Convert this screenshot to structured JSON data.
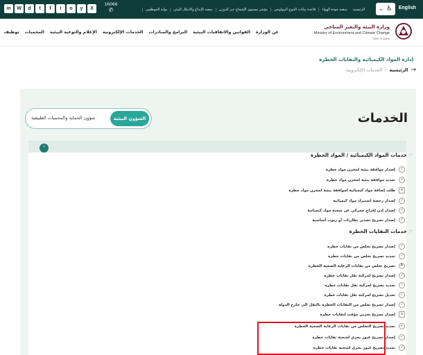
{
  "topbar": {
    "language": "English",
    "links": [
      "الرئيسية",
      "منصة جودة الهواء",
      "قاعدة بيانات التنوع البيولوجي",
      "مؤشر مستوى الإشعاع عبر الدوزن",
      "منصة الإبداع والابتكار البيئي",
      "بوابة الموظفين"
    ],
    "phone": "16066",
    "socials": [
      "in",
      "W",
      "d",
      "t",
      "f",
      "i",
      "o",
      "y",
      "X"
    ]
  },
  "header": {
    "logo_ar": "وزارة البيئة والتغير المناخي",
    "logo_en": "Ministry of Environment and Climate Change",
    "logo_sub": "State of Qatar",
    "nav": [
      "عن الوزارة",
      "القوانين والاتفاقيات البيئية",
      "البرامج والمبادرات",
      "الخدمات الإلكترونية",
      "الإعلام والتوعية البيئية",
      "المحميات",
      "توظيف"
    ]
  },
  "breadcrumb": {
    "home": "الرئيسية",
    "separator": "/",
    "current": "الخدمات الإلكترونية"
  },
  "main": {
    "title": "الخدمات",
    "toggle": {
      "active": "الشؤون البيئية",
      "other": "شؤون الحماية والمحميات الطبيعية"
    }
  },
  "category": {
    "title": "إدارة المواد الكيميائية والنفايات الخطرة",
    "groups": [
      {
        "title": "خدمات المواد الكيميائية / المواد الخطرة",
        "items": [
          {
            "label": "إصدار موافقة بيئية لمخزن مواد خطرة",
            "icon": "check"
          },
          {
            "label": "تجديد موافقة بيئية لمخزن مواد خطرة",
            "icon": "plus"
          },
          {
            "label": "طلب إضافة مواد كيميائية لموافقة بيئية لمخزن مواد خطرة",
            "icon": "doc"
          },
          {
            "label": "إصدار رخصة استيراد مواد كيميائية",
            "icon": "check"
          },
          {
            "label": "إصدار إذن إفراج جمركي عن شحنة مواد كيميائية",
            "icon": "check"
          },
          {
            "label": "إصدار تصريح تصدير بطاريات أو زيوت أساسية",
            "icon": "check"
          }
        ]
      },
      {
        "title": "خدمات النفايات الخطرة",
        "items": [
          {
            "label": "إصدار تصريح تخلص من نفايات خطرة",
            "icon": "check"
          },
          {
            "label": "تجديد تصريح تخلص من نفايات خطرة",
            "icon": "check"
          },
          {
            "label": "تصريح تخلص من نفايات الرعاية الصحية الخطرة",
            "icon": "leaf"
          },
          {
            "label": "إصدار تصريح لمركبة نقل نفايات خطرة",
            "icon": "check"
          },
          {
            "label": "تجديد تصريح لمركبة نقل نفايات خطرة",
            "icon": "check"
          },
          {
            "label": "تعديل تصريح لمركبة نقل نفايات خطرة",
            "icon": "check"
          },
          {
            "label": "إصدار تصريح تخلص من النفايات الخطرة بالنقل الى خارج الدولة",
            "icon": "check"
          },
          {
            "label": "إصدار تصريح تخزين مؤقت لنفايات خطرة",
            "icon": "doc"
          },
          {
            "label": "تجديد تصريح التخلص من نفايات الرعاية الصحية الخطرة",
            "icon": "plus"
          },
          {
            "label": "إصدار تصريح عبور بحري لشحنة نفايات خطرة",
            "icon": "check"
          },
          {
            "label": "تمديد تصريح عبور بحري لشحنة نفايات خطرة",
            "icon": "check"
          }
        ]
      }
    ]
  },
  "colors": {
    "topbar_bg": "#0f3d3a",
    "accent": "#2aa79b",
    "panel_bg": "#eef5f1",
    "highlight": "#e0111b"
  }
}
